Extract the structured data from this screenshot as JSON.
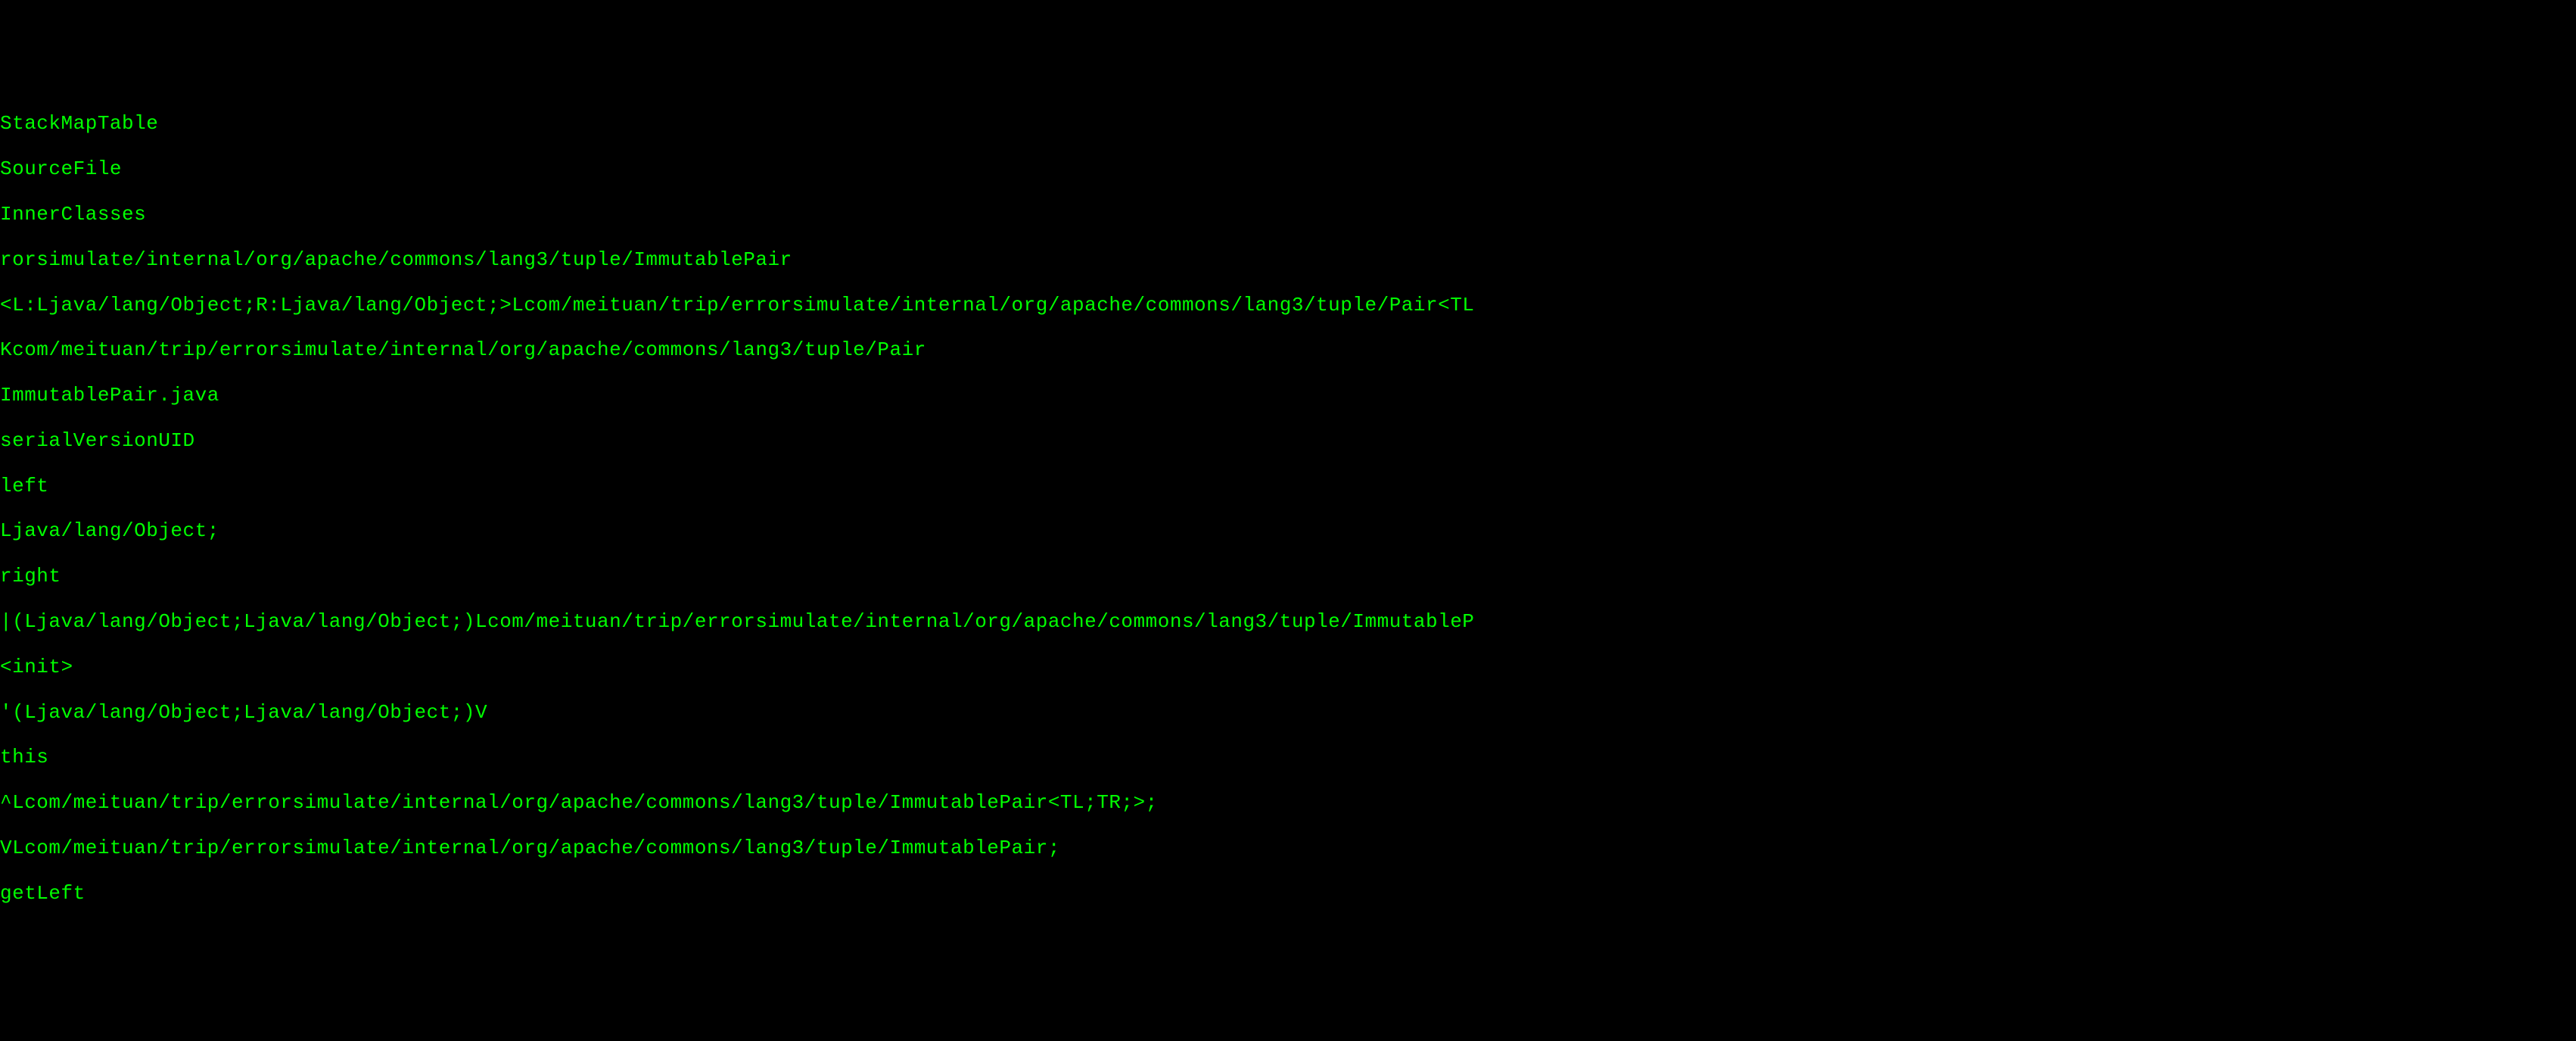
{
  "terminal": {
    "lines": [
      "StackMapTable",
      "SourceFile",
      "InnerClasses",
      "rorsimulate/internal/org/apache/commons/lang3/tuple/ImmutablePair",
      "<L:Ljava/lang/Object;R:Ljava/lang/Object;>Lcom/meituan/trip/errorsimulate/internal/org/apache/commons/lang3/tuple/Pair<TL",
      "Kcom/meituan/trip/errorsimulate/internal/org/apache/commons/lang3/tuple/Pair",
      "ImmutablePair.java",
      "serialVersionUID",
      "left",
      "Ljava/lang/Object;",
      "right",
      "|(Ljava/lang/Object;Ljava/lang/Object;)Lcom/meituan/trip/errorsimulate/internal/org/apache/commons/lang3/tuple/ImmutableP",
      "<init>",
      "'(Ljava/lang/Object;Ljava/lang/Object;)V",
      "this",
      "^Lcom/meituan/trip/errorsimulate/internal/org/apache/commons/lang3/tuple/ImmutablePair<TL;TR;>;",
      "VLcom/meituan/trip/errorsimulate/internal/org/apache/commons/lang3/tuple/ImmutablePair;",
      "getLeft"
    ]
  }
}
